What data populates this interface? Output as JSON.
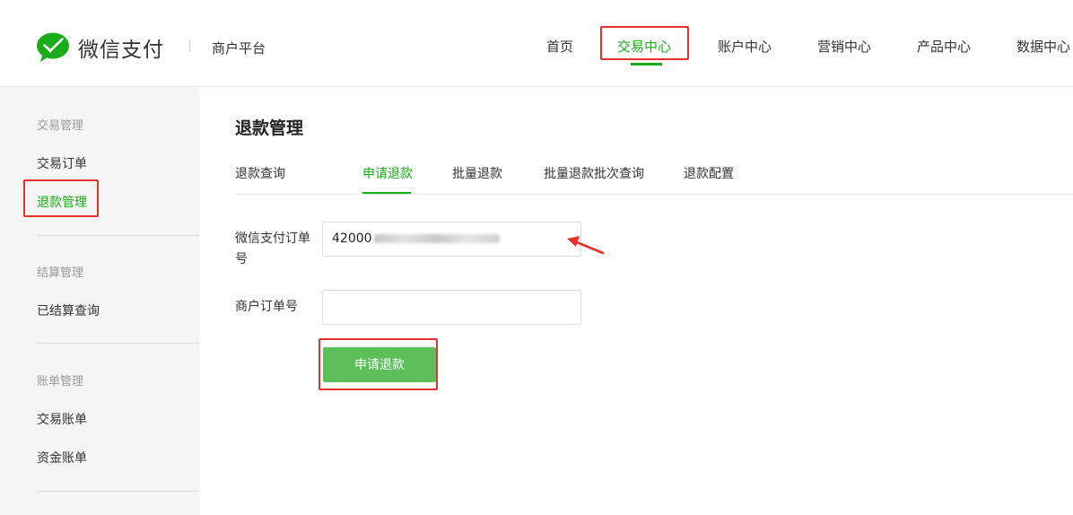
{
  "header": {
    "brand": "微信支付",
    "platform": "商户平台",
    "nav": [
      {
        "label": "首页"
      },
      {
        "label": "交易中心"
      },
      {
        "label": "账户中心"
      },
      {
        "label": "营销中心"
      },
      {
        "label": "产品中心"
      },
      {
        "label": "数据中心"
      }
    ],
    "active_nav": "交易中心"
  },
  "sidebar": {
    "groups": [
      {
        "title": "交易管理",
        "items": [
          "交易订单",
          "退款管理"
        ]
      },
      {
        "title": "结算管理",
        "items": [
          "已结算查询"
        ]
      },
      {
        "title": "账单管理",
        "items": [
          "交易账单",
          "资金账单"
        ]
      }
    ],
    "active_item": "退款管理"
  },
  "main": {
    "title": "退款管理",
    "tabs": [
      "退款查询",
      "申请退款",
      "批量退款",
      "批量退款批次查询",
      "退款配置"
    ],
    "active_tab": "申请退款",
    "form": {
      "wechat_order_label": "微信支付订单号",
      "wechat_order_value_visible": "42000",
      "merchant_order_label": "商户订单号",
      "merchant_order_value": "",
      "submit_label": "申请退款"
    }
  },
  "colors": {
    "accent": "#1aad19",
    "button": "#5cbf5a",
    "annotation": "#e8302c",
    "sidebar_bg": "#f5f5f5"
  },
  "icons": [
    "wechat-pay-logo-icon",
    "red-arrow-icon"
  ]
}
